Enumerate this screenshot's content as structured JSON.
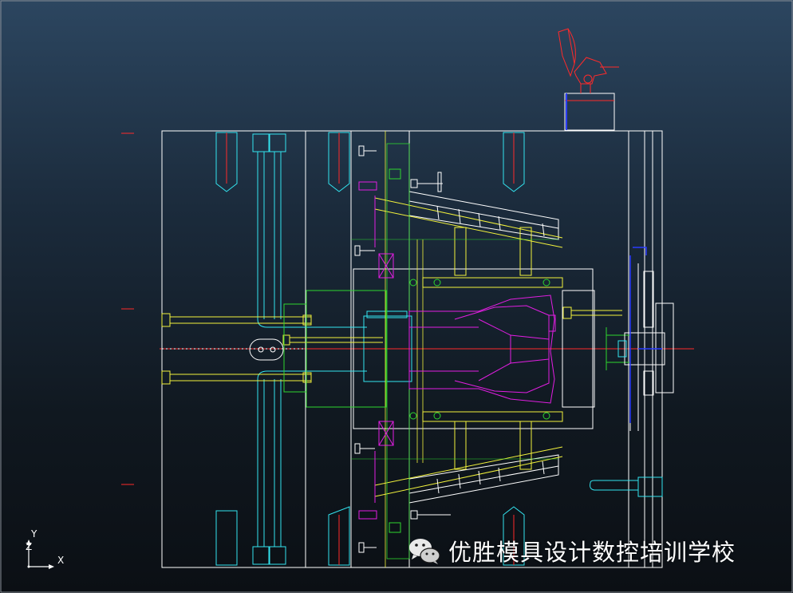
{
  "viewport": {
    "name": "cad-mold-drawing",
    "palette": {
      "outline": "#ffffff",
      "cyan": "#33e4ef",
      "yellow": "#f2f23c",
      "magenta": "#e21ee2",
      "green": "#2ed62e",
      "red": "#ff2a2a",
      "blue": "#2a3cff",
      "bg_top": "#2c4660",
      "bg_bottom": "#0b0f14"
    }
  },
  "triad": {
    "y_label": "Y",
    "z_label": "Z",
    "x_label": "X"
  },
  "watermark": {
    "icon": "wechat-icon",
    "text": "优胜模具设计数控培训学校"
  }
}
